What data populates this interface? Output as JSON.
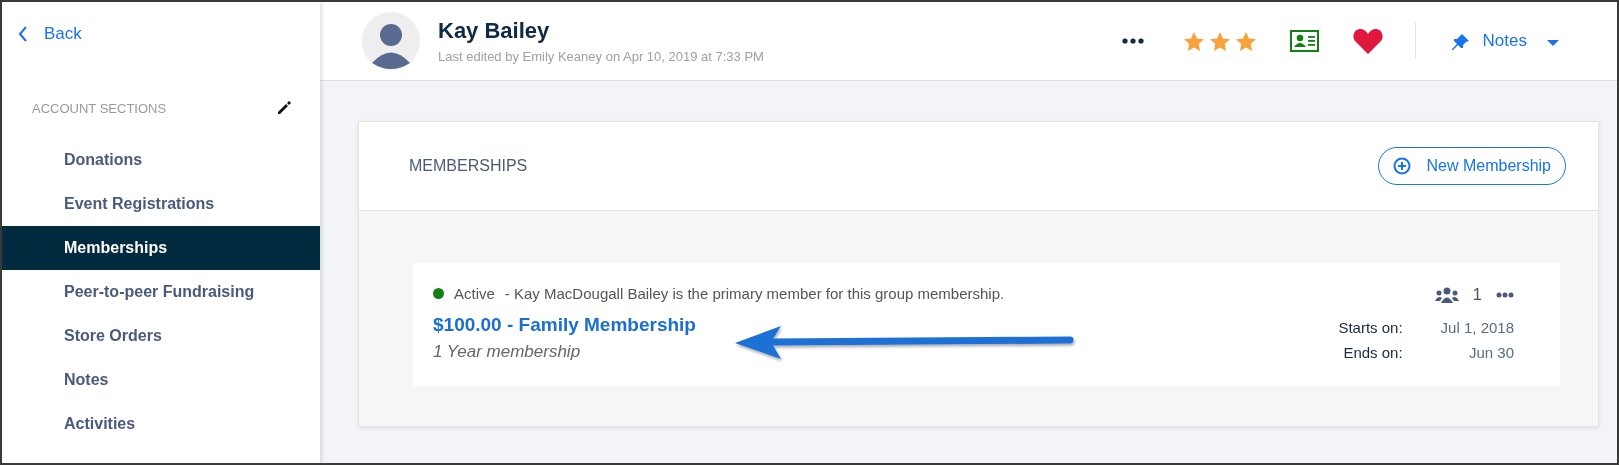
{
  "back": {
    "label": "Back"
  },
  "sidebar": {
    "heading": "ACCOUNT SECTIONS",
    "items": [
      {
        "label": "Donations",
        "selected": false
      },
      {
        "label": "Event Registrations",
        "selected": false
      },
      {
        "label": "Memberships",
        "selected": true
      },
      {
        "label": "Peer-to-peer Fundraising",
        "selected": false
      },
      {
        "label": "Store Orders",
        "selected": false
      },
      {
        "label": "Notes",
        "selected": false
      },
      {
        "label": "Activities",
        "selected": false
      }
    ]
  },
  "header": {
    "name": "Kay Bailey",
    "subtitle": "Last edited by Emily Keaney on Apr 10, 2019 at 7:33 PM",
    "rating": {
      "stars": 3
    },
    "notes_button": {
      "label": "Notes"
    }
  },
  "panel": {
    "title": "MEMBERSHIPS",
    "new_button": {
      "label": "New Membership"
    },
    "memberships": [
      {
        "status": "Active",
        "color": "#138013",
        "note": "- Kay MacDougall Bailey is the primary member for this group membership.",
        "title": "$100.00 - Family Membership",
        "term": "1 Year membership",
        "member_count": "1",
        "dates": [
          {
            "label": "Starts on:",
            "value": "Jul 1, 2018"
          },
          {
            "label": "Ends on:",
            "value": "Jun 30"
          }
        ]
      }
    ]
  }
}
